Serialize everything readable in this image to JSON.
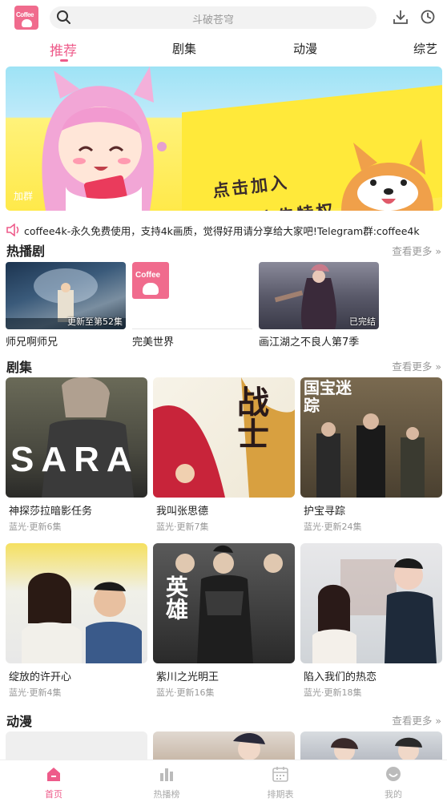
{
  "header": {
    "logo_text": "Coffee",
    "search_placeholder": "斗破苍穹"
  },
  "tabs": [
    {
      "label": "推荐",
      "active": true
    },
    {
      "label": "剧集",
      "active": false
    },
    {
      "label": "动漫",
      "active": false
    },
    {
      "label": "综艺",
      "active": false
    }
  ],
  "banner": {
    "line1": "点击加入",
    "line2": "加群领免广告特权",
    "tag": "加群"
  },
  "notice": "coffee4k-永久免费使用，支持4k画质，觉得好用请分享给大家吧!Telegram群:coffee4k",
  "hot_section": {
    "title": "热播剧",
    "more": "查看更多",
    "items": [
      {
        "name": "师兄啊师兄",
        "badge": "更新至第52集"
      },
      {
        "name": "完美世界",
        "badge": ""
      },
      {
        "name": "画江湖之不良人第7季",
        "badge": "已完结"
      }
    ]
  },
  "drama_section": {
    "title": "剧集",
    "more": "查看更多",
    "items": [
      {
        "name": "神探莎拉暗影任务",
        "sub": "蓝光·更新6集",
        "poster_text": "SARA"
      },
      {
        "name": "我叫张思德",
        "sub": "蓝光·更新7集",
        "poster_text": "战士"
      },
      {
        "name": "护宝寻踪",
        "sub": "蓝光·更新24集",
        "poster_text": "国宝迷踪"
      },
      {
        "name": "绽放的许开心",
        "sub": "蓝光·更新4集",
        "poster_text": ""
      },
      {
        "name": "紫川之光明王",
        "sub": "蓝光·更新16集",
        "poster_text": "英雄"
      },
      {
        "name": "陷入我们的热恋",
        "sub": "蓝光·更新18集",
        "poster_text": ""
      }
    ]
  },
  "anime_section": {
    "title": "动漫",
    "more": "查看更多"
  },
  "bottom_nav": [
    {
      "label": "首页",
      "active": true,
      "icon": "home-icon"
    },
    {
      "label": "热播榜",
      "active": false,
      "icon": "chart-icon"
    },
    {
      "label": "排期表",
      "active": false,
      "icon": "calendar-icon"
    },
    {
      "label": "我的",
      "active": false,
      "icon": "profile-icon"
    }
  ],
  "colors": {
    "accent": "#ee5b8a",
    "muted": "#999999"
  }
}
